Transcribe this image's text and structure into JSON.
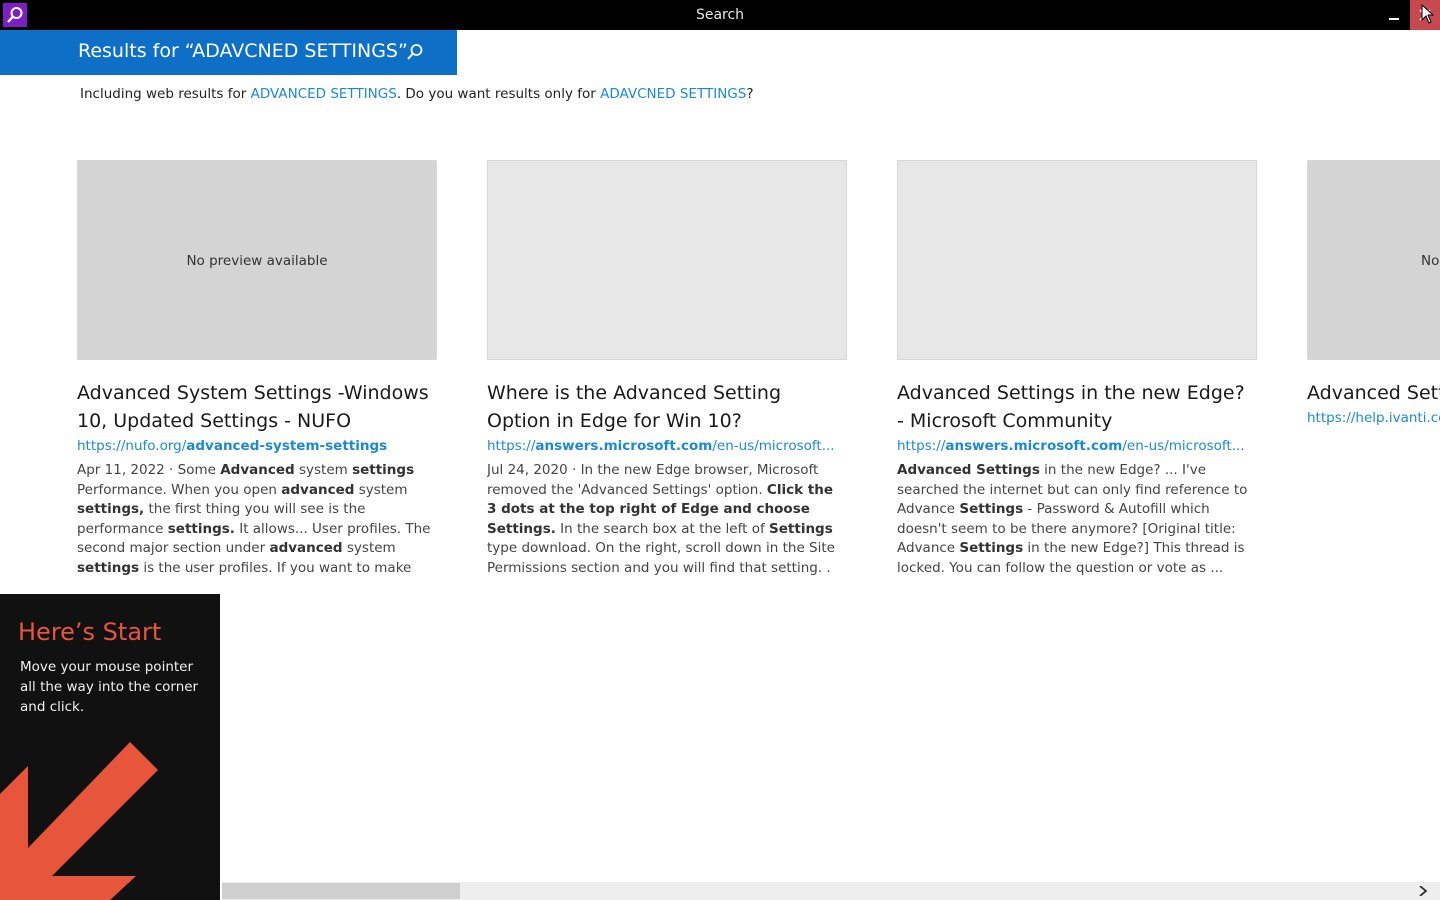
{
  "window": {
    "title": "Search",
    "accent_color": "#7a1fc4",
    "close_color": "#c7484e"
  },
  "query": {
    "heading": "Results for “ADAVCNED SETTINGS”",
    "accent_color": "#0d6fc6"
  },
  "spelling": {
    "prefix": "Including web results for ",
    "corrected": "ADVANCED SETTINGS",
    "middle": ". Do you want results only for ",
    "original": "ADAVCNED SETTINGS",
    "suffix": "?"
  },
  "results": [
    {
      "preview": "No preview available",
      "title": "Advanced System Settings -Windows 10, Updated Settings - NUFO",
      "url_plain": "https://nufo.org/",
      "url_bold": "advanced-system-settings",
      "snippet": [
        {
          "t": "Apr 11, 2022 · Some ",
          "b": false
        },
        {
          "t": "Advanced",
          "b": true
        },
        {
          "t": " system ",
          "b": false
        },
        {
          "t": "settings",
          "b": true
        },
        {
          "t": " Performance. When you open ",
          "b": false
        },
        {
          "t": "advanced",
          "b": true
        },
        {
          "t": " system ",
          "b": false
        },
        {
          "t": "settings,",
          "b": true
        },
        {
          "t": " the first thing you will see is the performance ",
          "b": false
        },
        {
          "t": "settings.",
          "b": true
        },
        {
          "t": " It allows... User profiles. The second major section under ",
          "b": false
        },
        {
          "t": "advanced",
          "b": true
        },
        {
          "t": " system ",
          "b": false
        },
        {
          "t": "settings",
          "b": true
        },
        {
          "t": " is the user profiles. If you want to make any... Startup and recovery. Now ...",
          "b": false
        }
      ]
    },
    {
      "preview": "",
      "title": "Where is the Advanced Setting Option in Edge for Win 10?",
      "url_plain": "https://",
      "url_bold": "answers.microsoft.com",
      "url_rest": "/en-us/microsoft...",
      "snippet": [
        {
          "t": "Jul 24, 2020 · In the new Edge browser, Microsoft removed the 'Advanced Settings' option. ",
          "b": false
        },
        {
          "t": "Click the 3 dots at the top right of Edge and choose Settings.",
          "b": true
        },
        {
          "t": " In the search box at the left of ",
          "b": false
        },
        {
          "t": "Settings",
          "b": true
        },
        {
          "t": " type download. On the right, scroll down in the Site Permissions section and you will find that setting. .",
          "b": false
        }
      ]
    },
    {
      "preview": "",
      "title": "Advanced Settings in the new Edge? - Microsoft Community",
      "url_plain": "https://",
      "url_bold": "answers.microsoft.com",
      "url_rest": "/en-us/microsoft...",
      "snippet": [
        {
          "t": "Advanced Settings",
          "b": true
        },
        {
          "t": " in the new Edge? ... I've searched the internet but can only find reference to Advance ",
          "b": false
        },
        {
          "t": "Settings",
          "b": true
        },
        {
          "t": " - Password & Autofill which doesn't seem to be there anymore? [Original title: Advance ",
          "b": false
        },
        {
          "t": "Settings",
          "b": true
        },
        {
          "t": " in the new Edge?] This thread is locked. You can follow the question or vote as ...",
          "b": false
        }
      ]
    },
    {
      "preview": "No",
      "title": "Advanced Sett",
      "url": "https://help.ivanti.co"
    }
  ],
  "start_tip": {
    "title": "Here’s Start",
    "body": "Move your mouse pointer all the way into the corner and click.",
    "accent_color": "#e7553a"
  }
}
